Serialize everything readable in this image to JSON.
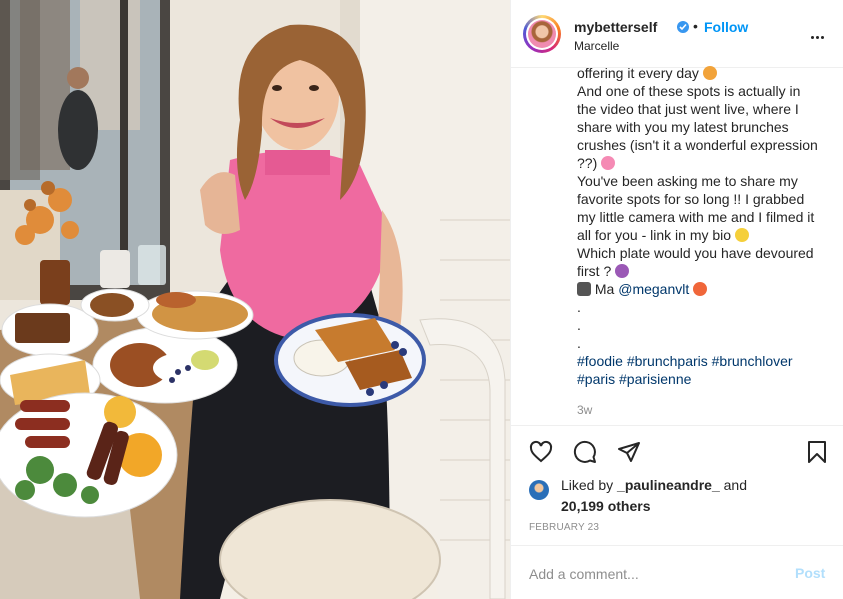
{
  "header": {
    "username": "mybetterself",
    "follow_label": "Follow",
    "separator": "•",
    "location": "Marcelle"
  },
  "caption": {
    "lines": [
      "offering it every day",
      "And one of these spots is actually in",
      "the video that just went live, where I",
      "share with you my latest brunches",
      "crushes (isn't it a wonderful expression",
      "??)",
      "You've been asking me to share my",
      "favorite spots for so long !! I grabbed",
      "my little camera with me and I filmed it",
      "all for you - link in my bio",
      "Which plate would you have devoured",
      "first ?",
      "Ma",
      ".",
      ".",
      "."
    ],
    "mention": "@meganvlt",
    "hashtags_line1": "#foodie #brunchparis #brunchlover",
    "hashtags_line2": "#paris #parisienne",
    "time_ago": "3w"
  },
  "likes": {
    "prefix": "Liked by",
    "user": "_paulineandre_",
    "and": "and",
    "count": "20,199 others"
  },
  "date": "FEBRUARY 23",
  "comment": {
    "placeholder": "Add a comment...",
    "post_label": "Post"
  },
  "icons": {
    "like": "heart-icon",
    "comment": "comment-icon",
    "share": "paper-plane-icon",
    "save": "bookmark-icon",
    "more": "more-options-icon",
    "verified": "verified-badge-icon"
  },
  "colors": {
    "accent": "#0095f6",
    "post_disabled": "#b2dffc",
    "mention": "#00376b",
    "secondary": "#8e8e8e"
  }
}
